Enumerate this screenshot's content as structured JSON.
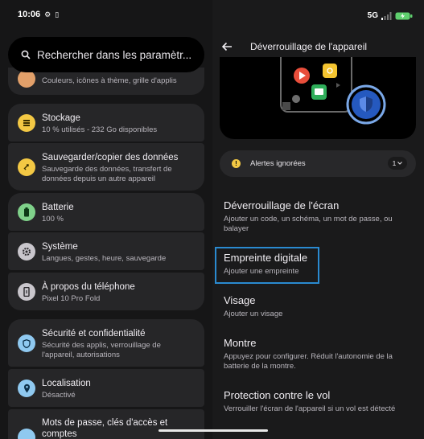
{
  "status_left": {
    "time": "10:06"
  },
  "status_right": {
    "network": "5G"
  },
  "search": {
    "placeholder": "Rechercher dans les paramètr..."
  },
  "settings": {
    "display_partial_sub": "Couleurs, icônes à thème, grille d'applis",
    "storage": {
      "title": "Stockage",
      "sub": "10 % utilisés - 232 Go disponibles",
      "color": "#f3c844"
    },
    "backup": {
      "title": "Sauvegarder/copier des données",
      "sub1": "Sauvegarde des données, transfert de",
      "sub2": "données depuis un autre appareil",
      "color": "#f3c844"
    },
    "battery": {
      "title": "Batterie",
      "sub": "100 %",
      "color": "#7fd18a"
    },
    "system": {
      "title": "Système",
      "sub": "Langues, gestes, heure, sauvegarde",
      "color": "#c9c6cc"
    },
    "about": {
      "title": "À propos du téléphone",
      "sub": "Pixel 10 Pro Fold",
      "color": "#c9c6cc"
    },
    "security": {
      "title": "Sécurité et confidentialité",
      "sub1": "Sécurité des applis, verrouillage de",
      "sub2": "l'appareil, autorisations",
      "color": "#8fc9f0"
    },
    "location": {
      "title": "Localisation",
      "sub": "Désactivé",
      "color": "#8fc9f0"
    },
    "passwords": {
      "title1": "Mots de passe, clés d'accès et",
      "title2": "comptes",
      "color": "#8fc9f0"
    }
  },
  "detail": {
    "title": "Déverrouillage de l'appareil",
    "alert": {
      "label": "Alertes ignorées",
      "count": "1"
    },
    "options": [
      {
        "title": "Déverrouillage de l'écran",
        "sub1": "Ajouter un code, un schéma, un mot de passe, ou",
        "sub2": "balayer"
      },
      {
        "title": "Empreinte digitale",
        "sub1": "Ajouter une empreinte",
        "sub2": ""
      },
      {
        "title": "Visage",
        "sub1": "Ajouter un visage",
        "sub2": ""
      },
      {
        "title": "Montre",
        "sub1": "Appuyez pour configurer. Réduit l'autonomie de la",
        "sub2": "batterie de la montre."
      },
      {
        "title": "Protection contre le vol",
        "sub1": "Verrouiller l'écran de l'appareil si un vol est détecté",
        "sub2": ""
      }
    ]
  }
}
